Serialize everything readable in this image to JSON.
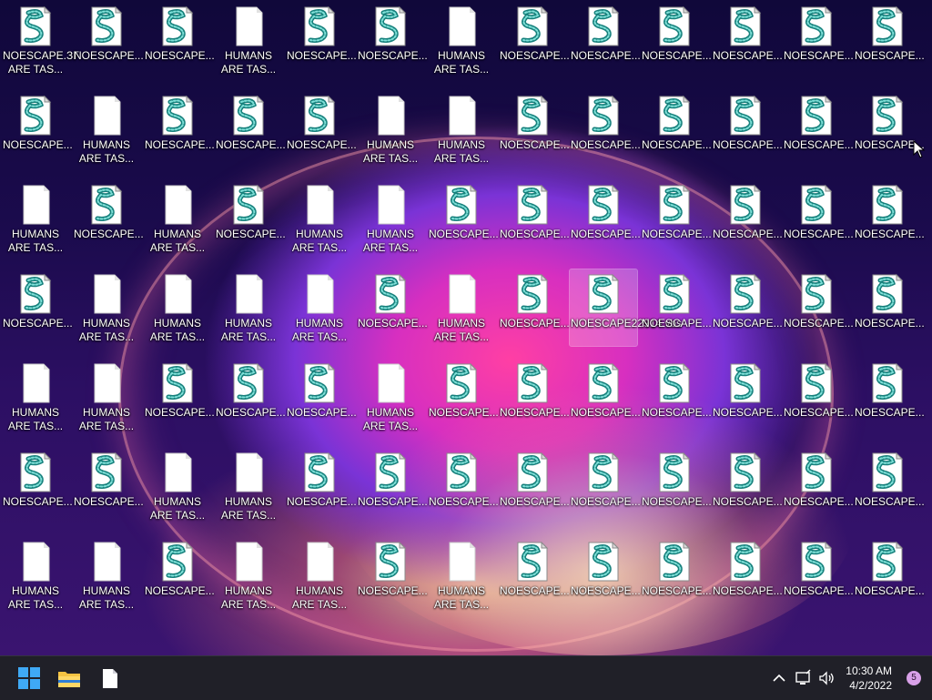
{
  "desktop": {
    "script_label": "NOESCAPE...",
    "text_label": "HUMANS ARE TAS...",
    "first_label": "NOESCAPE.ЗГ ARE TAS...",
    "selected_label": "NOESCAPE22914.vbs",
    "grid": [
      "SSSTSSTSSSSSS",
      "STSSSTTSSSSSS",
      "TSTSTTSSSSSSS",
      "STTTTSTSSSSSS",
      "TTSSSTSSSSSSS",
      "SSTTSSSSSSSSS",
      "TTSTTSTSSSSSS"
    ],
    "icons": [
      [
        {
          "label": "NOESCAPE.ЗГ ARE TAS...",
          "kind": "script"
        },
        {
          "label": "NOESCAPE...",
          "kind": "script"
        },
        {
          "label": "NOESCAPE...",
          "kind": "script"
        },
        {
          "label": "HUMANS ARE TAS...",
          "kind": "text"
        },
        {
          "label": "NOESCAPE...",
          "kind": "script"
        },
        {
          "label": "NOESCAPE...",
          "kind": "script"
        },
        {
          "label": "HUMANS ARE TAS...",
          "kind": "text"
        },
        {
          "label": "NOESCAPE...",
          "kind": "script"
        },
        {
          "label": "NOESCAPE...",
          "kind": "script"
        },
        {
          "label": "NOESCAPE...",
          "kind": "script"
        },
        {
          "label": "NOESCAPE...",
          "kind": "script"
        },
        {
          "label": "NOESCAPE...",
          "kind": "script"
        },
        {
          "label": "NOESCAPE...",
          "kind": "script"
        }
      ],
      [
        {
          "label": "NOESCAPE...",
          "kind": "script"
        },
        {
          "label": "HUMANS ARE TAS...",
          "kind": "text"
        },
        {
          "label": "NOESCAPE...",
          "kind": "script"
        },
        {
          "label": "NOESCAPE...",
          "kind": "script"
        },
        {
          "label": "NOESCAPE...",
          "kind": "script"
        },
        {
          "label": "HUMANS ARE TAS...",
          "kind": "text"
        },
        {
          "label": "HUMANS ARE TAS...",
          "kind": "text"
        },
        {
          "label": "NOESCAPE...",
          "kind": "script"
        },
        {
          "label": "NOESCAPE...",
          "kind": "script"
        },
        {
          "label": "NOESCAPE...",
          "kind": "script"
        },
        {
          "label": "NOESCAPE...",
          "kind": "script"
        },
        {
          "label": "NOESCAPE...",
          "kind": "script"
        },
        {
          "label": "NOESCAPE...",
          "kind": "script"
        }
      ],
      [
        {
          "label": "HUMANS ARE TAS...",
          "kind": "text"
        },
        {
          "label": "NOESCAPE...",
          "kind": "script"
        },
        {
          "label": "HUMANS ARE TAS...",
          "kind": "text"
        },
        {
          "label": "NOESCAPE...",
          "kind": "script"
        },
        {
          "label": "HUMANS ARE TAS...",
          "kind": "text"
        },
        {
          "label": "HUMANS ARE TAS...",
          "kind": "text"
        },
        {
          "label": "NOESCAPE...",
          "kind": "script"
        },
        {
          "label": "NOESCAPE...",
          "kind": "script"
        },
        {
          "label": "NOESCAPE...",
          "kind": "script"
        },
        {
          "label": "NOESCAPE...",
          "kind": "script"
        },
        {
          "label": "NOESCAPE...",
          "kind": "script"
        },
        {
          "label": "NOESCAPE...",
          "kind": "script"
        },
        {
          "label": "NOESCAPE...",
          "kind": "script"
        }
      ],
      [
        {
          "label": "NOESCAPE...",
          "kind": "script"
        },
        {
          "label": "HUMANS ARE TAS...",
          "kind": "text"
        },
        {
          "label": "HUMANS ARE TAS...",
          "kind": "text"
        },
        {
          "label": "HUMANS ARE TAS...",
          "kind": "text"
        },
        {
          "label": "HUMANS ARE TAS...",
          "kind": "text"
        },
        {
          "label": "NOESCAPE...",
          "kind": "script"
        },
        {
          "label": "HUMANS ARE TAS...",
          "kind": "text"
        },
        {
          "label": "NOESCAPE...",
          "kind": "script"
        },
        {
          "label": "NOESCAPE22914.vbs",
          "kind": "script",
          "selected": true
        },
        {
          "label": "NOESCAPE...",
          "kind": "script"
        },
        {
          "label": "NOESCAPE...",
          "kind": "script"
        },
        {
          "label": "NOESCAPE...",
          "kind": "script"
        },
        {
          "label": "NOESCAPE...",
          "kind": "script"
        }
      ],
      [
        {
          "label": "HUMANS ARE TAS...",
          "kind": "text"
        },
        {
          "label": "HUMANS ARE TAS...",
          "kind": "text"
        },
        {
          "label": "NOESCAPE...",
          "kind": "script"
        },
        {
          "label": "NOESCAPE...",
          "kind": "script"
        },
        {
          "label": "NOESCAPE...",
          "kind": "script"
        },
        {
          "label": "HUMANS ARE TAS...",
          "kind": "text"
        },
        {
          "label": "NOESCAPE...",
          "kind": "script"
        },
        {
          "label": "NOESCAPE...",
          "kind": "script"
        },
        {
          "label": "NOESCAPE...",
          "kind": "script"
        },
        {
          "label": "NOESCAPE...",
          "kind": "script"
        },
        {
          "label": "NOESCAPE...",
          "kind": "script"
        },
        {
          "label": "NOESCAPE...",
          "kind": "script"
        },
        {
          "label": "NOESCAPE...",
          "kind": "script"
        }
      ],
      [
        {
          "label": "NOESCAPE...",
          "kind": "script"
        },
        {
          "label": "NOESCAPE...",
          "kind": "script"
        },
        {
          "label": "HUMANS ARE TAS...",
          "kind": "text"
        },
        {
          "label": "HUMANS ARE TAS...",
          "kind": "text"
        },
        {
          "label": "NOESCAPE...",
          "kind": "script"
        },
        {
          "label": "NOESCAPE...",
          "kind": "script"
        },
        {
          "label": "NOESCAPE...",
          "kind": "script"
        },
        {
          "label": "NOESCAPE...",
          "kind": "script"
        },
        {
          "label": "NOESCAPE...",
          "kind": "script"
        },
        {
          "label": "NOESCAPE...",
          "kind": "script"
        },
        {
          "label": "NOESCAPE...",
          "kind": "script"
        },
        {
          "label": "NOESCAPE...",
          "kind": "script"
        },
        {
          "label": "NOESCAPE...",
          "kind": "script"
        }
      ],
      [
        {
          "label": "HUMANS ARE TAS...",
          "kind": "text"
        },
        {
          "label": "HUMANS ARE TAS...",
          "kind": "text"
        },
        {
          "label": "NOESCAPE...",
          "kind": "script"
        },
        {
          "label": "HUMANS ARE TAS...",
          "kind": "text"
        },
        {
          "label": "HUMANS ARE TAS...",
          "kind": "text"
        },
        {
          "label": "NOESCAPE...",
          "kind": "script"
        },
        {
          "label": "HUMANS ARE TAS...",
          "kind": "text"
        },
        {
          "label": "NOESCAPE...",
          "kind": "script"
        },
        {
          "label": "NOESCAPE...",
          "kind": "script"
        },
        {
          "label": "NOESCAPE...",
          "kind": "script"
        },
        {
          "label": "NOESCAPE...",
          "kind": "script"
        },
        {
          "label": "NOESCAPE...",
          "kind": "script"
        },
        {
          "label": "NOESCAPE...",
          "kind": "script"
        }
      ]
    ]
  },
  "taskbar": {
    "start_icon": "windows-start-icon",
    "explorer_icon": "file-explorer-icon",
    "notepad_icon": "text-document-icon",
    "tray_chevron": "chevron-up-icon",
    "network_icon": "network-icon",
    "volume_icon": "speaker-icon",
    "time": "10:30 AM",
    "date": "4/2/2022",
    "notification_count": "5"
  },
  "colors": {
    "accent": "#0078d4",
    "taskbar": "#202028",
    "script_teal": "#2aa7a0"
  }
}
